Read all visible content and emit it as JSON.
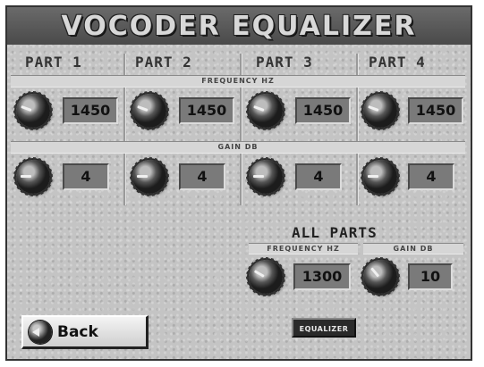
{
  "title": "VOCODER EQUALIZER",
  "parts": [
    {
      "label": "PART 1",
      "frequency": "1450",
      "gain": "4"
    },
    {
      "label": "PART 2",
      "frequency": "1450",
      "gain": "4"
    },
    {
      "label": "PART 3",
      "frequency": "1450",
      "gain": "4"
    },
    {
      "label": "PART 4",
      "frequency": "1450",
      "gain": "4"
    }
  ],
  "sections": {
    "frequency_label": "FREQUENCY HZ",
    "gain_label": "GAIN DB"
  },
  "all_parts": {
    "label": "ALL PARTS",
    "frequency_label": "FREQUENCY HZ",
    "gain_label": "GAIN DB",
    "frequency": "1300",
    "gain": "10"
  },
  "buttons": {
    "back": "Back",
    "equalizer_toggle": "EQUALIZER"
  },
  "icons": {
    "knob": "rotary-knob-icon",
    "back": "back-arrow-icon"
  },
  "colors": {
    "background": "#c4c4c4",
    "title_bar": "#5a5a5a",
    "value_box": "#7a7a7a"
  }
}
